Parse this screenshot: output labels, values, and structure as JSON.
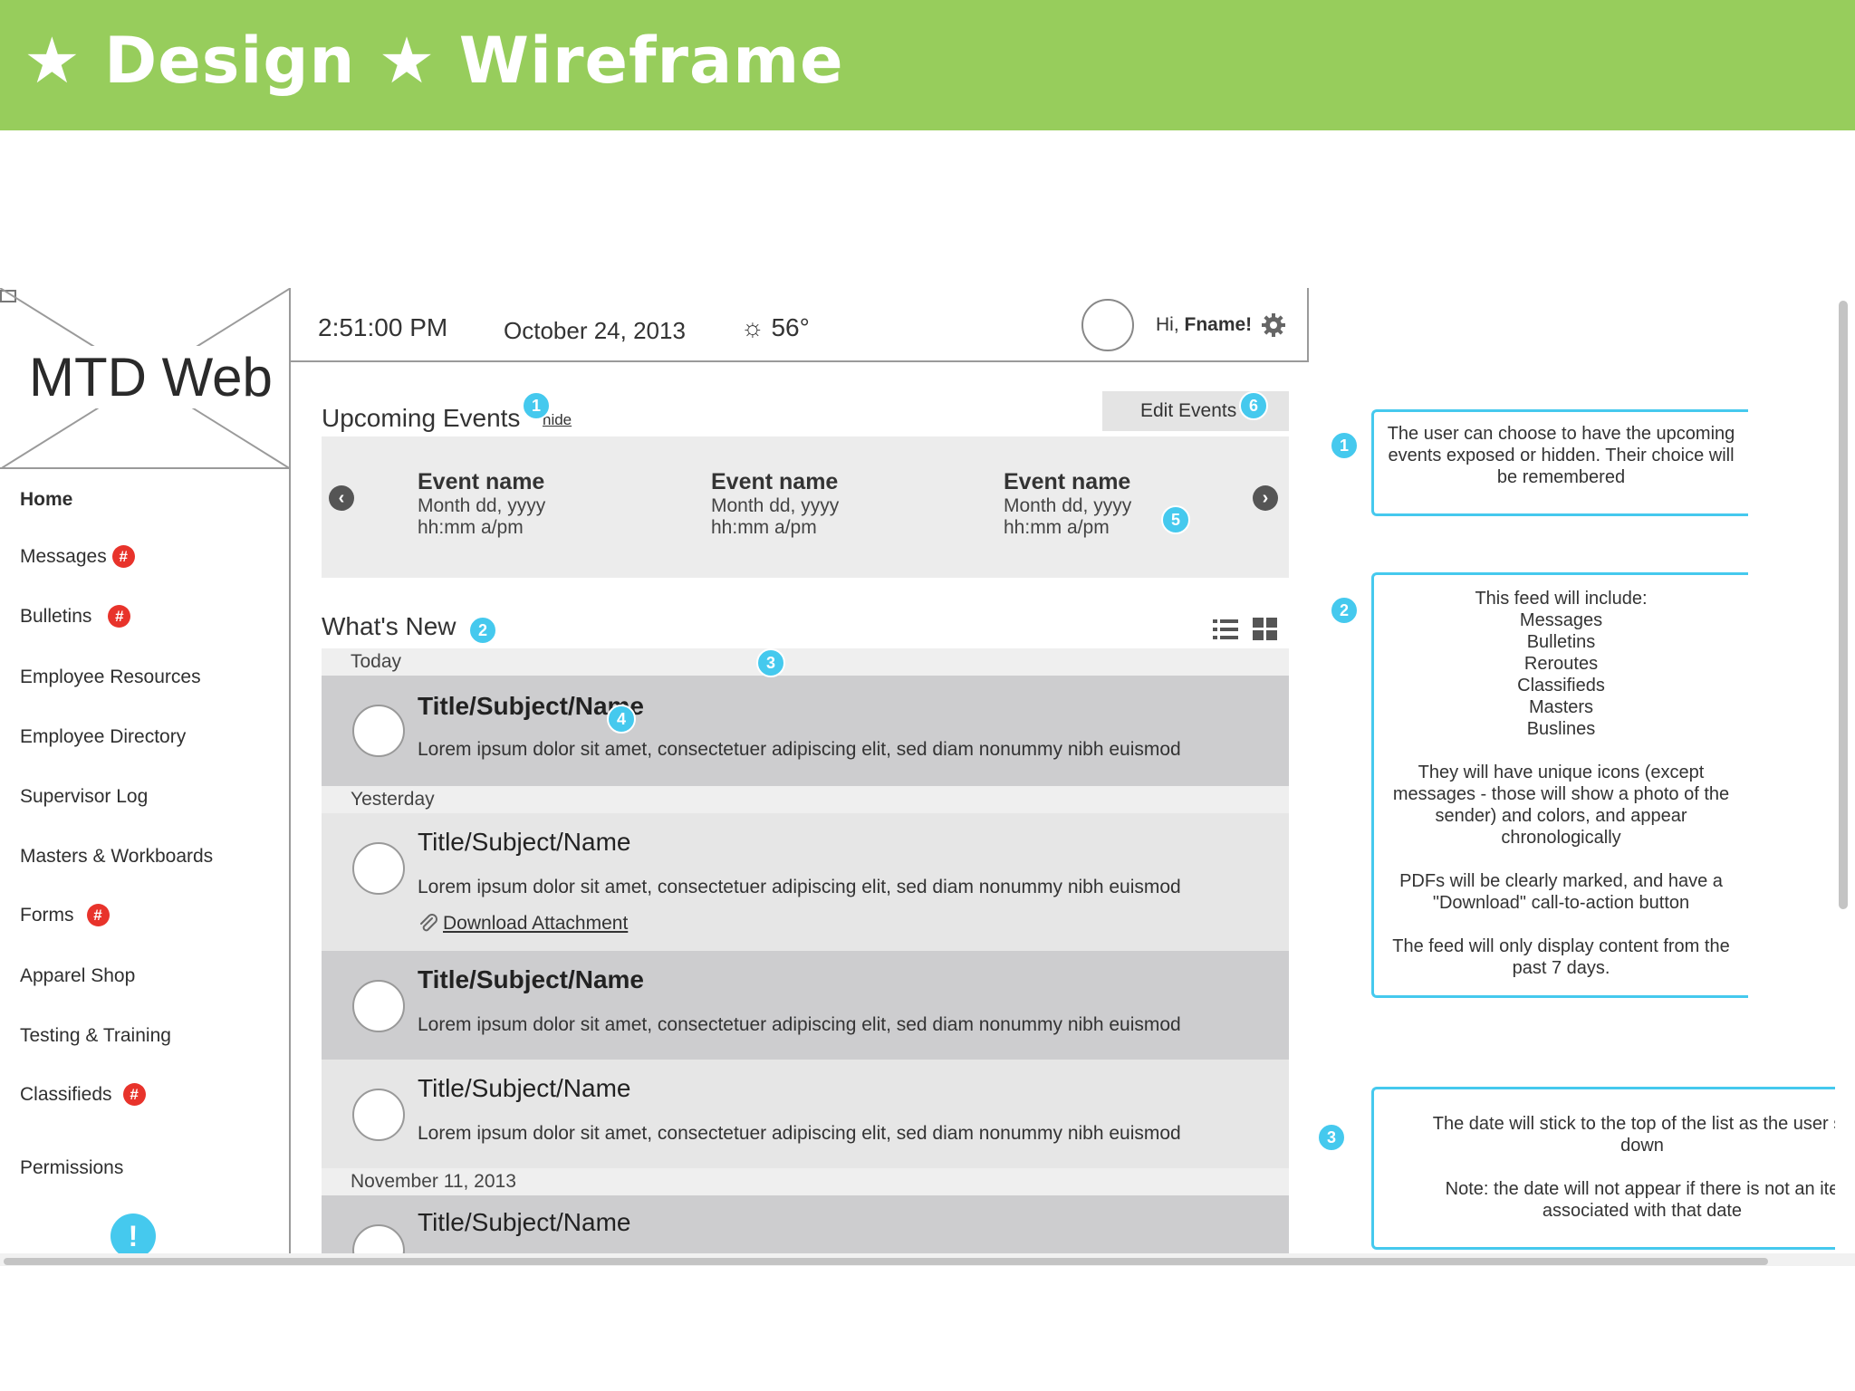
{
  "banner": {
    "title": "★ Design ★ Wireframe"
  },
  "app": {
    "logo_text": "MTD Web"
  },
  "sidebar": {
    "items": [
      {
        "label": "Home",
        "badge": ""
      },
      {
        "label": "Messages",
        "badge": "#"
      },
      {
        "label": "Bulletins",
        "badge": "#"
      },
      {
        "label": "Employee Resources",
        "badge": ""
      },
      {
        "label": "Employee Directory",
        "badge": ""
      },
      {
        "label": "Supervisor Log",
        "badge": ""
      },
      {
        "label": "Masters & Workboards",
        "badge": ""
      },
      {
        "label": "Forms",
        "badge": "#"
      },
      {
        "label": "Apparel Shop",
        "badge": ""
      },
      {
        "label": "Testing & Training",
        "badge": ""
      },
      {
        "label": "Classifieds",
        "badge": "#"
      },
      {
        "label": "Permissions",
        "badge": ""
      }
    ],
    "alert_glyph": "!"
  },
  "topbar": {
    "time": "2:51:00 PM",
    "date": "October 24, 2013",
    "weather": "☼ 56°",
    "greeting_prefix": "Hi, ",
    "greeting_name": "Fname!",
    "icons": {
      "avatar": "avatar-placeholder",
      "settings": "gear-icon",
      "weather": "sun-icon"
    }
  },
  "upcoming": {
    "title": "Upcoming Events",
    "hide_label": "hide",
    "edit_label": "Edit Events",
    "prev_glyph": "‹",
    "next_glyph": "›",
    "events": [
      {
        "name": "Event name",
        "date": "Month dd, yyyy",
        "time": "hh:mm a/pm"
      },
      {
        "name": "Event name",
        "date": "Month dd, yyyy",
        "time": "hh:mm a/pm"
      },
      {
        "name": "Event name",
        "date": "Month dd, yyyy",
        "time": "hh:mm a/pm"
      }
    ]
  },
  "whats_new": {
    "title": "What's New",
    "view_icons": [
      "list-view-icon",
      "grid-view-icon"
    ],
    "groups": [
      {
        "date": "Today"
      },
      {
        "date": "Yesterday"
      },
      {
        "date": "November 11, 2013"
      }
    ],
    "items": [
      {
        "title": "Title/Subject/Name",
        "body": "Lorem ipsum dolor sit amet, consectetuer adipiscing elit, sed diam nonummy nibh euismod",
        "attachment": ""
      },
      {
        "title": "Title/Subject/Name",
        "body": "Lorem ipsum dolor sit amet, consectetuer adipiscing elit, sed diam nonummy nibh euismod",
        "attachment": "Download Attachment"
      },
      {
        "title": "Title/Subject/Name",
        "body": "Lorem ipsum dolor sit amet, consectetuer adipiscing elit, sed diam nonummy nibh euismod",
        "attachment": ""
      },
      {
        "title": "Title/Subject/Name",
        "body": "Lorem ipsum dolor sit amet, consectetuer adipiscing elit, sed diam nonummy nibh euismod",
        "attachment": ""
      },
      {
        "title": "Title/Subject/Name",
        "body": "",
        "attachment": ""
      }
    ]
  },
  "markers": [
    "1",
    "2",
    "3",
    "4",
    "5",
    "6"
  ],
  "notes": [
    {
      "number": "1",
      "text": "The user can choose to have the upcoming events exposed or hidden. Their choice will be remembered"
    },
    {
      "number": "2",
      "text": "This feed will include:\nMessages\nBulletins\nReroutes\nClassifieds\nMasters\nBuslines\n\nThey will have unique icons (except messages - those will show a photo of the sender) and colors, and appear chronologically\n\nPDFs will be clearly marked, and have a \"Download\" call-to-action button\n\nThe feed will only display content from the past 7 days."
    },
    {
      "number": "3",
      "text": "The date will stick to the top of the list as the user sc\ndown\n\nNote: the date will not appear if there is not an ite\nassociated with that date"
    }
  ],
  "colors": {
    "banner": "#97cd5c",
    "accent": "#45c9ee",
    "badge": "#e8332b"
  }
}
